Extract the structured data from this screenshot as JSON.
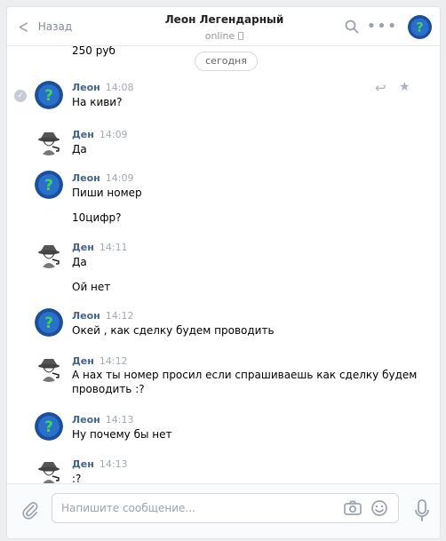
{
  "header": {
    "back_label": "Назад",
    "title": "Леон Легендарный",
    "status": "online"
  },
  "date_divider": "сегодня",
  "top_partial_text": "250 руб",
  "messages": [
    {
      "author": "Леон",
      "time": "14:08",
      "lines": [
        "На киви?"
      ],
      "avatar": "leon"
    },
    {
      "author": "Ден",
      "time": "14:09",
      "lines": [
        "Да"
      ],
      "avatar": "den"
    },
    {
      "author": "Леон",
      "time": "14:09",
      "lines": [
        "Пиши номер",
        "10цифр?"
      ],
      "avatar": "leon"
    },
    {
      "author": "Ден",
      "time": "14:11",
      "lines": [
        "Да",
        "Ой нет"
      ],
      "avatar": "den"
    },
    {
      "author": "Леон",
      "time": "14:12",
      "lines": [
        "Окей , как сделку будем проводить"
      ],
      "avatar": "leon"
    },
    {
      "author": "Ден",
      "time": "14:12",
      "lines": [
        "А нах ты номер просил если спрашиваешь как сделку будем",
        "проводить :?"
      ],
      "avatar": "den"
    },
    {
      "author": "Леон",
      "time": "14:13",
      "lines": [
        "Ну почему бы нет"
      ],
      "avatar": "leon"
    },
    {
      "author": "Ден",
      "time": "14:13",
      "lines": [
        ":?"
      ],
      "avatar": "den"
    }
  ],
  "composer": {
    "placeholder": "Напишите сообщение..."
  },
  "icons": {
    "back": "chevron-left-icon",
    "search": "search-icon",
    "more": "more-dots-icon",
    "attach": "paperclip-icon",
    "camera": "camera-icon",
    "emoji": "smile-icon",
    "mic": "microphone-icon",
    "reply": "reply-icon",
    "star": "star-icon",
    "read": "check-icon"
  },
  "colors": {
    "accent": "#42648b",
    "background": "#edeef0"
  }
}
